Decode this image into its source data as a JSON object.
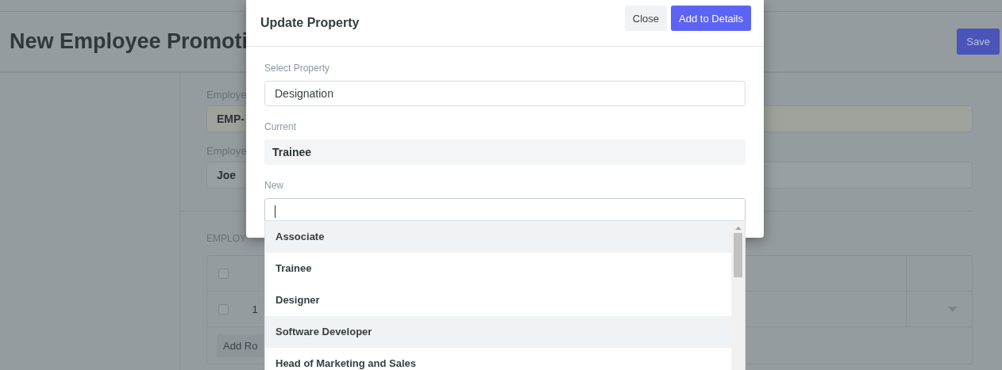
{
  "page": {
    "title": "New Employee Promoti",
    "save_button": "Save",
    "fields": [
      {
        "label": "Employe",
        "value": "EMP-",
        "kind": "readonly"
      },
      {
        "label": "Employe",
        "value": "Joe",
        "kind": "link"
      }
    ],
    "section_label": "EMPLOY",
    "table": {
      "header_checkbox": {
        "checked": false
      },
      "rows": [
        {
          "checked": false,
          "index": "1"
        }
      ],
      "add_row_button": "Add Ro"
    }
  },
  "dialog": {
    "title": "Update Property",
    "buttons": [
      {
        "label": "Close",
        "kind": "secondary"
      },
      {
        "label": "Add to Details",
        "kind": "primary"
      }
    ],
    "select_property": {
      "label": "Select Property",
      "value": "Designation"
    },
    "current": {
      "label": "Current",
      "value": "Trainee"
    },
    "new": {
      "label": "New",
      "focused": true
    },
    "suggestions": [
      {
        "label": "Associate",
        "highlighted": true
      },
      {
        "label": "Trainee",
        "highlighted": false
      },
      {
        "label": "Designer",
        "highlighted": false
      },
      {
        "label": "Software Developer",
        "highlighted": true
      },
      {
        "label": "Head of Marketing and Sales",
        "highlighted": false
      }
    ]
  }
}
